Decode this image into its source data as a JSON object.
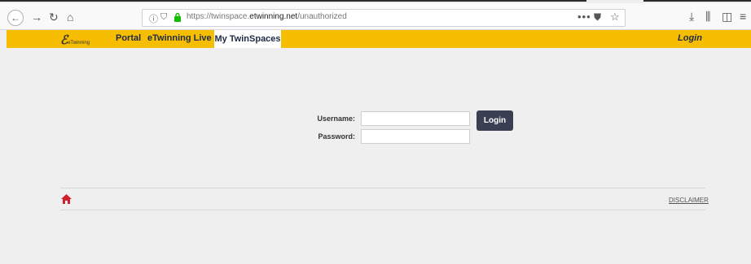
{
  "browser": {
    "url_prefix": "https://twinspace.",
    "url_domain": "etwinning.net",
    "url_path": "/unauthorized",
    "more_glyph": "•••",
    "icons": [
      "back-icon",
      "forward-icon",
      "reload-icon",
      "home-icon",
      "info-icon",
      "shield-icon",
      "lock-icon",
      "pocket-icon",
      "bookmark-star-icon",
      "download-icon",
      "library-icon",
      "sidebar-icon",
      "menu-icon"
    ]
  },
  "nav": {
    "logo_mark": "ℰ",
    "logo_text": "eTwinning",
    "links": [
      "Portal",
      "eTwinning Live"
    ],
    "active_link": "My TwinSpaces",
    "login": "Login"
  },
  "form": {
    "username_label": "Username:",
    "password_label": "Password:",
    "username_value": "",
    "password_value": "",
    "login_button": "Login"
  },
  "footer": {
    "disclaimer": "DISCLAIMER",
    "home_icon_color": "#d0202e"
  },
  "colors": {
    "navbar": "#f7bd00",
    "button": "#3b3f52",
    "page_bg": "#efefef"
  }
}
